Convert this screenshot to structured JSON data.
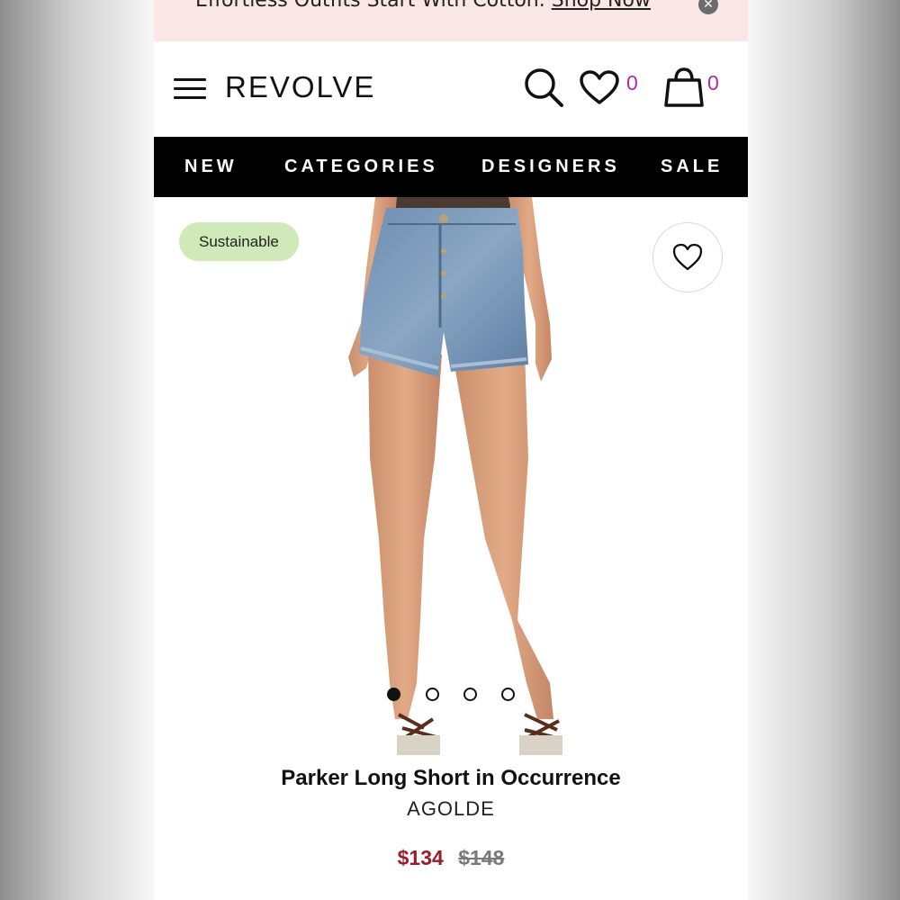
{
  "promo": {
    "text": "Effortless Outfits Start With Cotton.",
    "link": "Shop Now",
    "close_glyph": "✕"
  },
  "header": {
    "logo": "REVOLVE",
    "wishlist_count": "0",
    "bag_count": "0",
    "icons": [
      "menu-icon",
      "search-icon",
      "heart-icon",
      "bag-icon"
    ]
  },
  "nav": {
    "items": [
      "NEW",
      "CATEGORIES",
      "DESIGNERS",
      "SALE"
    ]
  },
  "product": {
    "badge": "Sustainable",
    "name": "Parker Long Short in Occurrence",
    "brand": "AGOLDE",
    "price_sale": "$134",
    "price_original": "$148",
    "image_count": 4,
    "active_image": 1
  },
  "colors": {
    "accent_count": "#b02ab0",
    "sale_price": "#9c1c2c",
    "badge_bg": "#cfeab8",
    "nav_bg": "#000000",
    "promo_bg": "#fbe6e6"
  }
}
